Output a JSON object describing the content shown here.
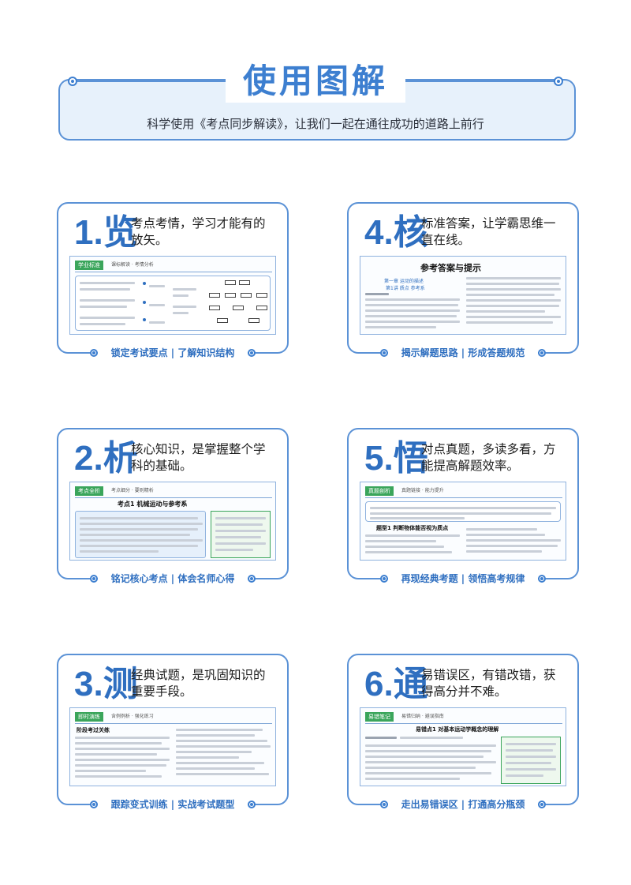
{
  "header": {
    "title": "使用图解",
    "subtitle": "科学使用《考点同步解读》，让我们一起在通往成功的道路上前行"
  },
  "cards": [
    {
      "num": "1.览",
      "desc": "考点考情，学习才能有的放矢。",
      "caption": "锁定考试要点 | 了解知识结构",
      "shot": {
        "tag": "学业标准",
        "tag_sub": "课标解读 · 考情分析"
      }
    },
    {
      "num": "4.核",
      "desc": "标准答案，让学霸思维一直在线。",
      "caption": "揭示解题思路 | 形成答题规范",
      "shot": {
        "title": "参考答案与提示",
        "chapter": "第一章  运动的描述",
        "lesson": "第1讲  质点  参考系"
      }
    },
    {
      "num": "2.析",
      "desc": "核心知识，是掌握整个学科的基础。",
      "caption": "铭记核心考点 | 体会名师心得",
      "shot": {
        "tag": "考点全析",
        "tag_sub": "考点细分 · 要则精析",
        "point": "考点1  机械运动与参考系"
      }
    },
    {
      "num": "5.悟",
      "desc": "对点真题，多读多看，方能提高解题效率。",
      "caption": "再现经典考题 | 领悟高考规律",
      "shot": {
        "tag": "真题剖析",
        "tag_sub": "真题链接 · 能力提升",
        "point": "题型1  判断物体能否视为质点"
      }
    },
    {
      "num": "3.测",
      "desc": "经典试题，是巩固知识的重要手段。",
      "caption": "跟踪变式训练 | 实战考试题型",
      "shot": {
        "tag": "即时演练",
        "tag_sub": "含例例析 · 强化练习",
        "section": "阶段考过关练"
      }
    },
    {
      "num": "6.通",
      "desc": "易错误区，有错改错，获得高分并不难。",
      "caption": "走出易错误区 | 打通高分瓶颈",
      "shot": {
        "tag": "易错笔记",
        "tag_sub": "易错归纳 · 避误指南",
        "point": "易错点1  对基本运动学概念的理解"
      }
    }
  ],
  "colors": {
    "accent": "#3d7fd0",
    "border": "#5b92d6",
    "header_bg": "#e7f1fb",
    "tag_green": "#3aa55b"
  }
}
